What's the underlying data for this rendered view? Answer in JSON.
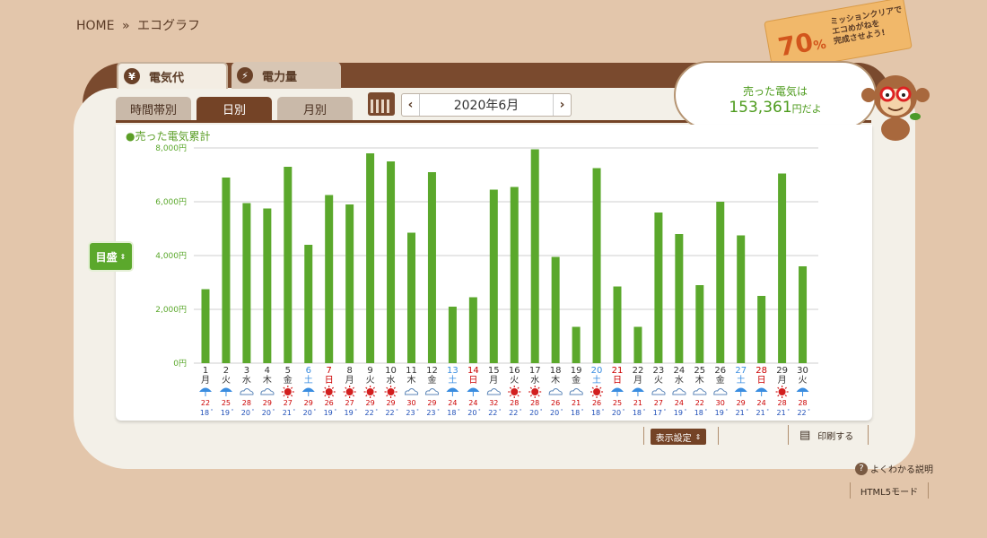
{
  "breadcrumb": {
    "home": "HOME",
    "sep": "»",
    "current": "エコグラフ"
  },
  "tabs": [
    {
      "label": "電気代",
      "icon": "yen-icon",
      "symbol": "¥"
    },
    {
      "label": "電力量",
      "icon": "lightning-icon",
      "symbol": "⚡"
    }
  ],
  "subtabs": [
    "時間帯別",
    "日別",
    "月別"
  ],
  "date_nav": {
    "prev": "‹",
    "next": "›",
    "value": "2020年6月"
  },
  "legend": "●売った電気累計",
  "target_button": "目盛",
  "bubble": {
    "line1": "売った電気は",
    "amount": "153,361",
    "suffix": "円だよ"
  },
  "mission": {
    "percent": "70",
    "unit": "%",
    "text1": "ミッションクリアで",
    "text2": "エコめがねを",
    "text3": "完成させよう!"
  },
  "buttons": {
    "display_settings": "表示設定",
    "print": "印刷する"
  },
  "help_link": "よくわかる説明",
  "html5_link": "HTML5モード",
  "colors": {
    "bar": "#5ba82c",
    "brown": "#744326",
    "saturday": "#3a8de0",
    "sunday": "#cc0000",
    "high_temp": "#cc0000",
    "low_temp": "#1f4fb8"
  },
  "chart_data": {
    "type": "bar",
    "ylabel": "",
    "ylim": [
      0,
      8000
    ],
    "ytick_labels": [
      "0円",
      "2,000円",
      "4,000円",
      "6,000円",
      "8,000円"
    ],
    "categories": [
      "1",
      "2",
      "3",
      "4",
      "5",
      "6",
      "7",
      "8",
      "9",
      "10",
      "11",
      "12",
      "13",
      "14",
      "15",
      "16",
      "17",
      "18",
      "19",
      "20",
      "21",
      "22",
      "23",
      "24",
      "25",
      "26",
      "27",
      "28",
      "29",
      "30"
    ],
    "weekdays": [
      "月",
      "火",
      "水",
      "木",
      "金",
      "土",
      "日",
      "月",
      "火",
      "水",
      "木",
      "金",
      "土",
      "日",
      "月",
      "火",
      "水",
      "木",
      "金",
      "土",
      "日",
      "月",
      "火",
      "水",
      "木",
      "金",
      "土",
      "日",
      "月",
      "火"
    ],
    "values": [
      2750,
      6900,
      5950,
      5750,
      7300,
      4400,
      6250,
      5900,
      7800,
      7500,
      4850,
      7100,
      2100,
      2450,
      6450,
      6550,
      7950,
      3950,
      1350,
      7250,
      2850,
      1350,
      5600,
      4800,
      2900,
      6000,
      4750,
      2500,
      7050,
      3600
    ],
    "weather": [
      "rain",
      "rain",
      "cloud",
      "cloud",
      "sun",
      "rain",
      "sun",
      "sun",
      "sun",
      "sun",
      "cloud",
      "cloud",
      "rain",
      "rain",
      "cloud",
      "sun",
      "sun",
      "cloud",
      "cloud",
      "sun",
      "rain",
      "rain",
      "cloud",
      "cloud",
      "cloud",
      "cloud",
      "rain",
      "rain",
      "sun",
      "rain"
    ],
    "high": [
      "22",
      "25",
      "28",
      "29",
      "27",
      "29",
      "26",
      "27",
      "29",
      "29",
      "30",
      "29",
      "24",
      "24",
      "32",
      "28",
      "28",
      "26",
      "21",
      "26",
      "25",
      "21",
      "27",
      "24",
      "22",
      "30",
      "29",
      "24",
      "28",
      "28"
    ],
    "low": [
      "18",
      "19",
      "20",
      "20",
      "21",
      "20",
      "19",
      "19",
      "22",
      "22",
      "23",
      "23",
      "18",
      "20",
      "22",
      "22",
      "20",
      "20",
      "18",
      "18",
      "20",
      "18",
      "17",
      "19",
      "18",
      "19",
      "21",
      "21",
      "21",
      "22"
    ]
  }
}
